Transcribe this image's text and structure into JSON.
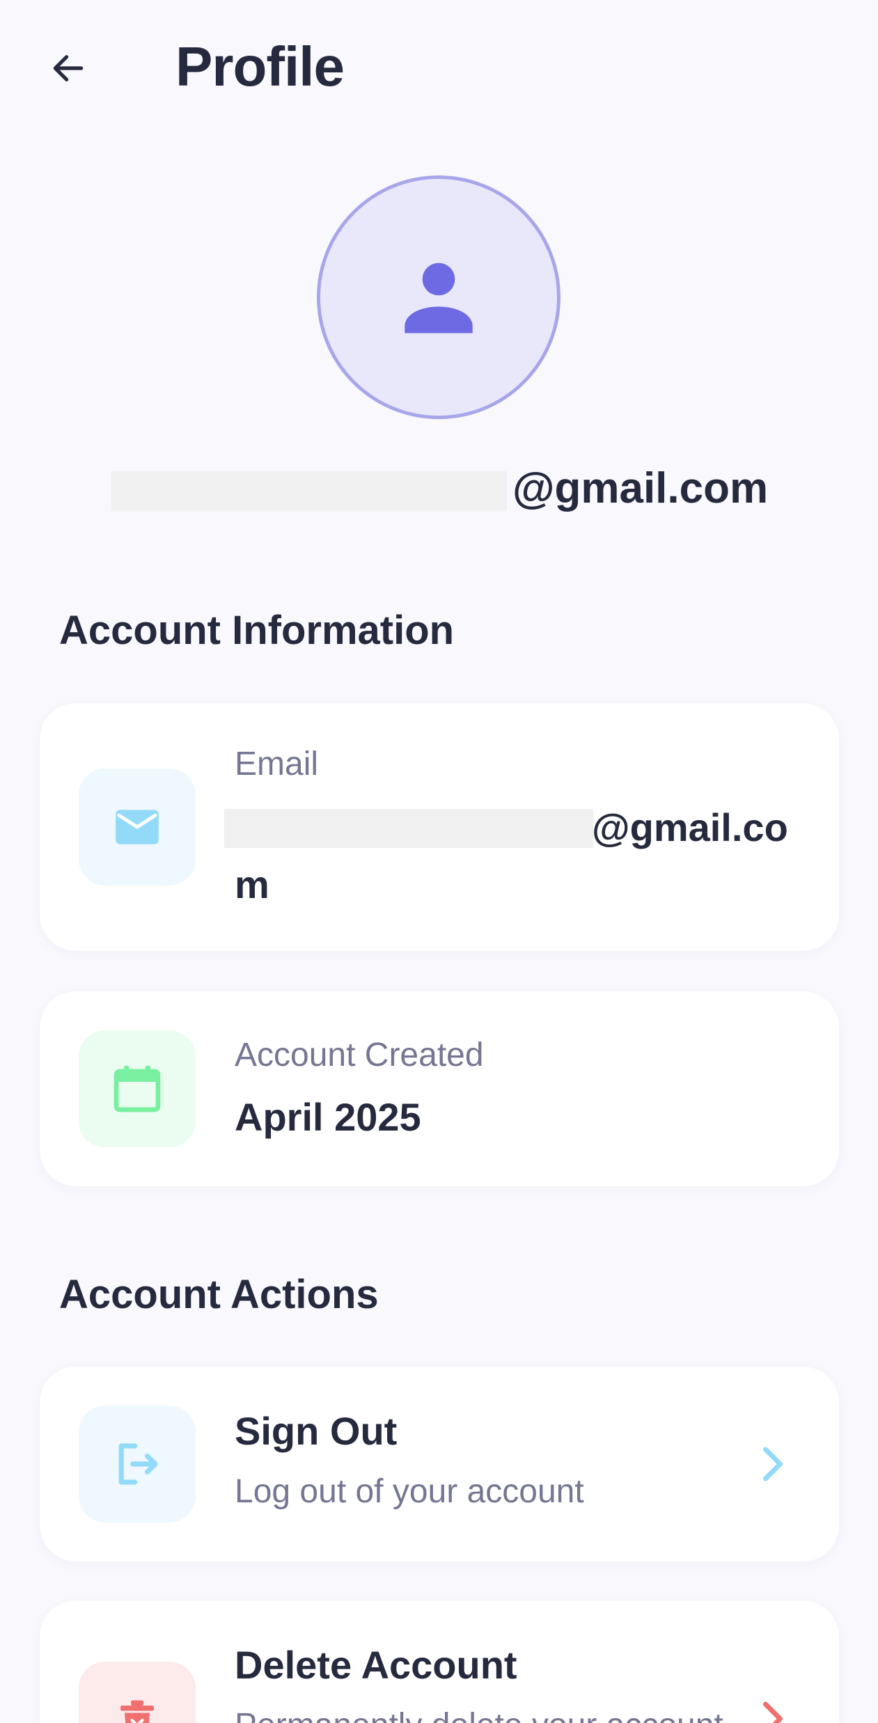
{
  "header": {
    "title": "Profile"
  },
  "profile": {
    "email_suffix": "@gmail.com"
  },
  "sections": {
    "account_information": "Account Information",
    "account_actions": "Account Actions"
  },
  "info": {
    "email": {
      "label": "Email",
      "value_line1": "@gmail.co",
      "value_line2": "m"
    },
    "created": {
      "label": "Account Created",
      "value": "April 2025"
    }
  },
  "actions": {
    "sign_out": {
      "title": "Sign Out",
      "subtitle": "Log out of your account"
    },
    "delete": {
      "title": "Delete Account",
      "subtitle": "Permanently delete your account"
    }
  },
  "icons": {
    "back": "arrow-left-icon",
    "avatar": "person-icon",
    "email": "envelope-icon",
    "created": "calendar-icon",
    "sign_out": "logout-icon",
    "delete": "trash-icon",
    "chevron": "chevron-right-icon"
  },
  "colors": {
    "background": "#f8f8fd",
    "accent": "#6e6ae4",
    "email_icon": "#93daf8",
    "calendar_icon": "#78f0a0",
    "signout_icon": "#93daf8",
    "delete_icon": "#f07070"
  }
}
